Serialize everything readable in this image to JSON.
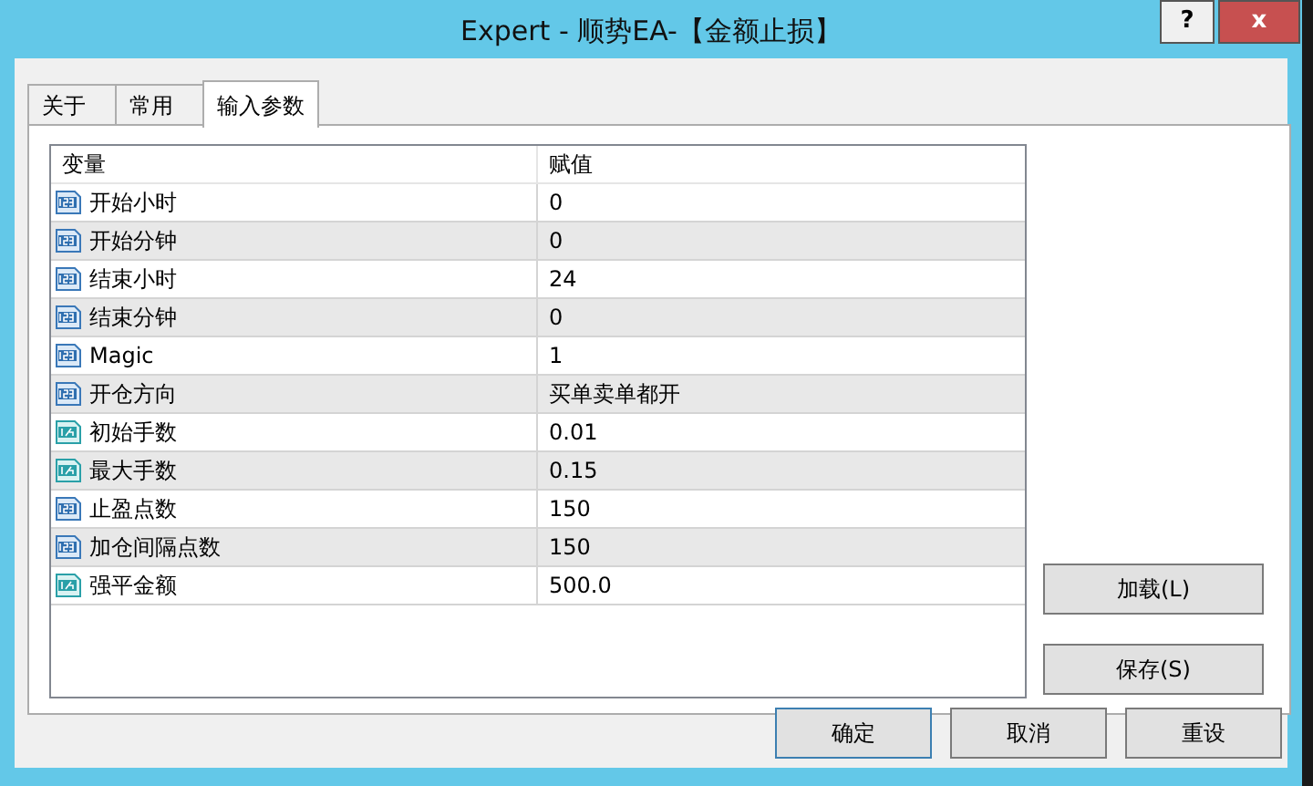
{
  "window": {
    "title": "Expert - 顺势EA-【金额止损】",
    "help": "?",
    "close": "x"
  },
  "tabs": [
    {
      "label": "关于",
      "selected": false
    },
    {
      "label": "常用",
      "selected": false
    },
    {
      "label": "输入参数",
      "selected": true
    }
  ],
  "table": {
    "columns": [
      "变量",
      "赋值"
    ],
    "rows": [
      {
        "kind": "int",
        "name": "开始小时",
        "value": "0"
      },
      {
        "kind": "int",
        "name": "开始分钟",
        "value": "0"
      },
      {
        "kind": "int",
        "name": "结束小时",
        "value": "24"
      },
      {
        "kind": "int",
        "name": "结束分钟",
        "value": "0"
      },
      {
        "kind": "int",
        "name": "Magic",
        "value": "1"
      },
      {
        "kind": "int",
        "name": "开仓方向",
        "value": "买单卖单都开"
      },
      {
        "kind": "double",
        "name": "初始手数",
        "value": "0.01"
      },
      {
        "kind": "double",
        "name": "最大手数",
        "value": "0.15"
      },
      {
        "kind": "int",
        "name": "止盈点数",
        "value": "150"
      },
      {
        "kind": "int",
        "name": "加仓间隔点数",
        "value": "150"
      },
      {
        "kind": "double",
        "name": "强平金额",
        "value": "500.0"
      }
    ]
  },
  "side_buttons": [
    "加载(L)",
    "保存(S)"
  ],
  "buttons": [
    {
      "label": "确定",
      "selected": true
    },
    {
      "label": "取消",
      "selected": false
    },
    {
      "label": "重设",
      "selected": false
    }
  ]
}
